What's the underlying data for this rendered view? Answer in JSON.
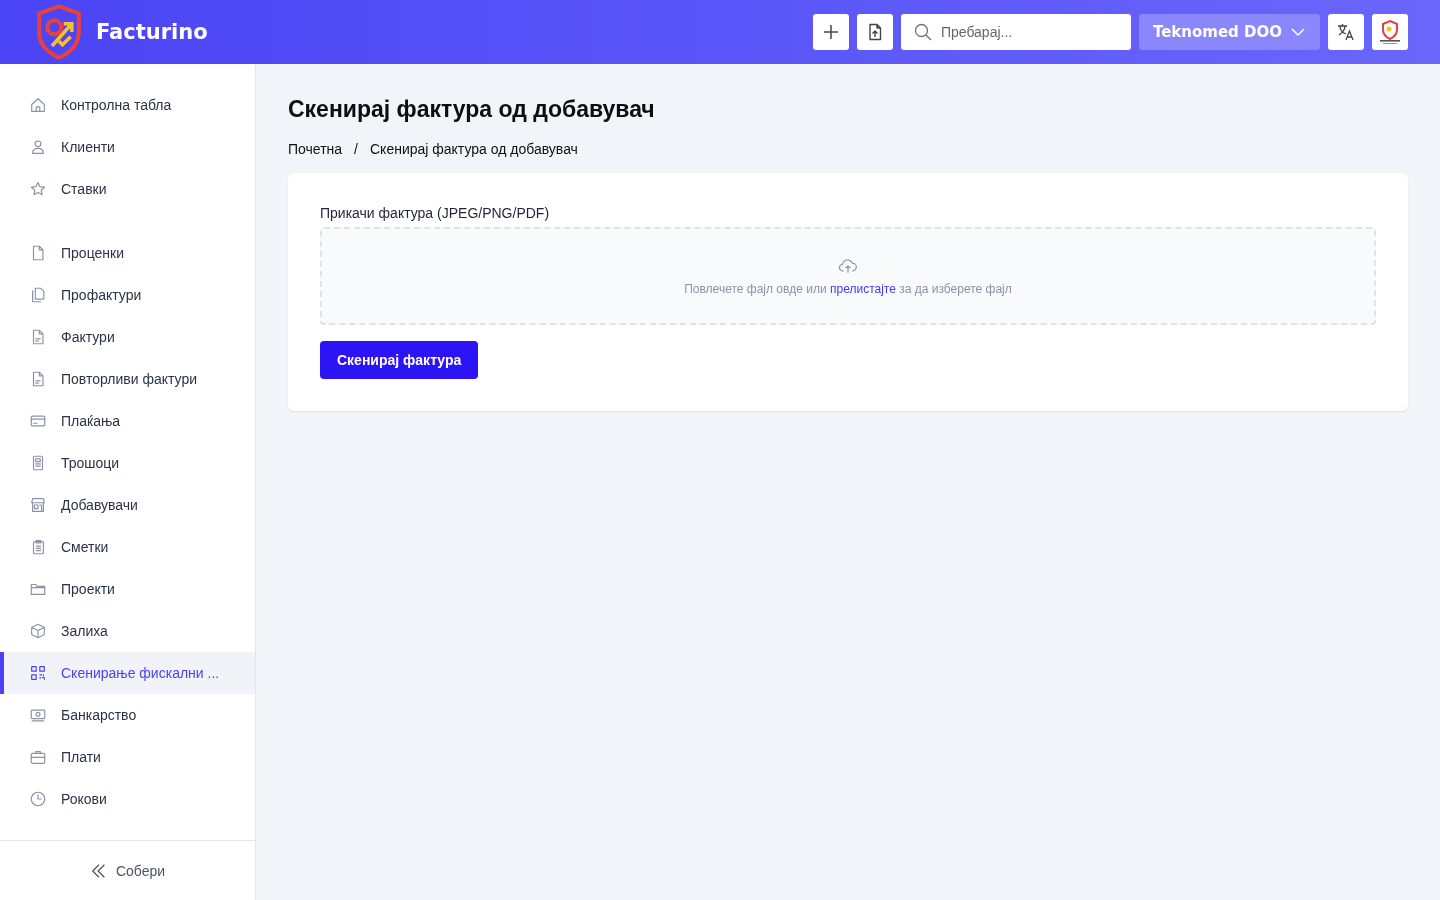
{
  "header": {
    "brand": "Facturino",
    "search": {
      "placeholder": "Пребарај..."
    },
    "company": "Teknomed DOO"
  },
  "sidebar": {
    "groups": [
      [
        {
          "label": "Контролна табла",
          "selected": false
        },
        {
          "label": "Клиенти",
          "selected": false
        },
        {
          "label": "Ставки",
          "selected": false
        }
      ],
      [
        {
          "label": "Проценки",
          "selected": false
        },
        {
          "label": "Профактури",
          "selected": false
        },
        {
          "label": "Фактури",
          "selected": false
        },
        {
          "label": "Повторливи фактури",
          "selected": false
        },
        {
          "label": "Плаќања",
          "selected": false
        },
        {
          "label": "Трошоци",
          "selected": false
        },
        {
          "label": "Добавувачи",
          "selected": false
        },
        {
          "label": "Сметки",
          "selected": false
        },
        {
          "label": "Проекти",
          "selected": false
        },
        {
          "label": "Залиха",
          "selected": false
        },
        {
          "label": "Скенирање фискални ...",
          "selected": true
        },
        {
          "label": "Банкарство",
          "selected": false
        },
        {
          "label": "Плати",
          "selected": false
        },
        {
          "label": "Рокови",
          "selected": false
        }
      ]
    ],
    "collapse": "Собери"
  },
  "page": {
    "title": "Скенирај фактура од добавувач",
    "breadcrumbs": [
      "Почетна",
      "Скенирај фактура од добавувач"
    ],
    "breadcrumb_separator": "/",
    "upload": {
      "label": "Прикачи фактура (JPEG/PNG/PDF)",
      "hint_before": "Повлечете фајл овде или",
      "hint_link": "прелистајте",
      "hint_after": "за да изберете фајл"
    },
    "button": "Скенирај фактура"
  }
}
